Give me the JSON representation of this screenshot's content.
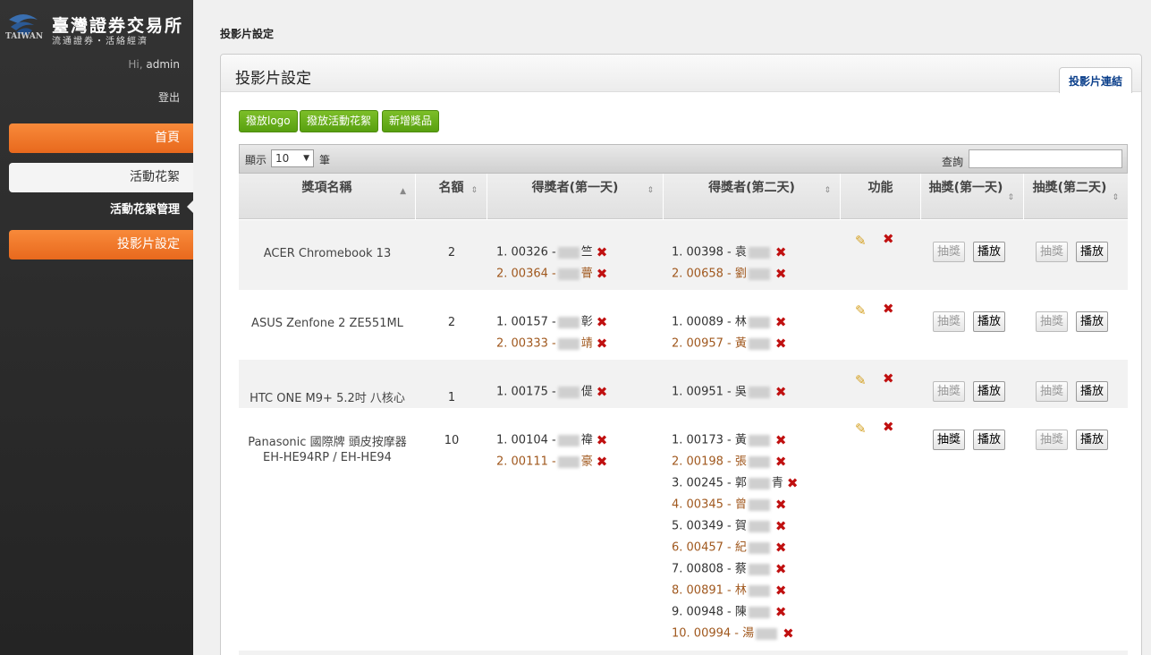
{
  "sidebar": {
    "logo_cn": "臺灣證券交易所",
    "logo_sub": "流通證券・活絡經濟",
    "logo_en": "TAIWAN",
    "greeting": "Hi,",
    "user": "admin",
    "logout": "登出",
    "nav": {
      "home": "首頁",
      "events": "活動花絮",
      "events_manage": "活動花絮管理",
      "slides": "投影片設定"
    }
  },
  "breadcrumb": "投影片設定",
  "panel": {
    "title": "投影片設定",
    "tab": "投影片連結",
    "buttons": {
      "logo": "撥放logo",
      "events": "撥放活動花絮",
      "add": "新增獎品"
    }
  },
  "table": {
    "show": "顯示",
    "length": "10",
    "unit": "筆",
    "search": "查詢",
    "headers": [
      "獎項名稱",
      "名額",
      "得獎者(第一天)",
      "得獎者(第二天)",
      "功能",
      "抽獎(第一天)",
      "抽獎(第二天)"
    ],
    "draw": "抽獎",
    "play": "播放",
    "rows": [
      {
        "name": "ACER Chromebook 13",
        "qty": "2",
        "day1": [
          {
            "n": "1. 00326 -",
            "s": "竺"
          },
          {
            "n": "2. 00364 -",
            "s": "瞢"
          }
        ],
        "day2": [
          {
            "n": "1. 00398 - 袁",
            "s": ""
          },
          {
            "n": "2. 00658 - 劉",
            "s": ""
          }
        ]
      },
      {
        "name": "ASUS Zenfone 2 ZE551ML",
        "qty": "2",
        "day1": [
          {
            "n": "1. 00157 -",
            "s": "彰"
          },
          {
            "n": "2. 00333 -",
            "s": "靖"
          }
        ],
        "day2": [
          {
            "n": "1. 00089 - 林",
            "s": ""
          },
          {
            "n": "2. 00957 - 黃",
            "s": ""
          }
        ]
      },
      {
        "name": "HTC ONE M9+ 5.2吋 八核心",
        "qty": "1",
        "day1": [
          {
            "n": "1. 00175 -",
            "s": "偍"
          }
        ],
        "day2": [
          {
            "n": "1. 00951 - 吳",
            "s": ""
          }
        ]
      },
      {
        "name1": "Panasonic 國際牌 頭皮按摩器",
        "name2": "EH-HE94RP / EH-HE94",
        "qty": "10",
        "day1": [
          {
            "n": "1. 00104 -",
            "s": "禕"
          },
          {
            "n": "2. 00111 -",
            "s": "豪"
          }
        ],
        "day2": [
          {
            "n": "1. 00173 - 黃",
            "s": ""
          },
          {
            "n": "2. 00198 - 張",
            "s": ""
          },
          {
            "n": "3. 00245 - 郭",
            "s": "青"
          },
          {
            "n": "4. 00345 - 曾",
            "s": ""
          },
          {
            "n": "5. 00349 - 賀",
            "s": ""
          },
          {
            "n": "6. 00457 - 紀",
            "s": ""
          },
          {
            "n": "7. 00808 - 蔡",
            "s": ""
          },
          {
            "n": "8. 00891 - 林",
            "s": ""
          },
          {
            "n": "9. 00948 - 陳",
            "s": ""
          },
          {
            "n": "10. 00994 - 湯",
            "s": ""
          }
        ]
      }
    ]
  }
}
